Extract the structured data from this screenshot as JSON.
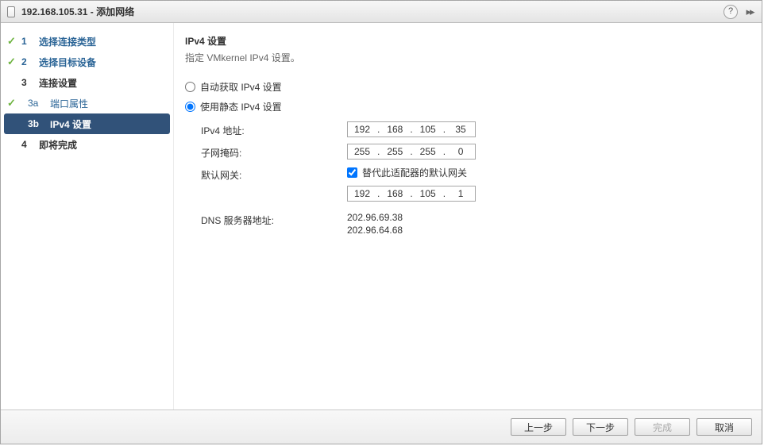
{
  "titlebar": {
    "title": "192.168.105.31 - 添加网络"
  },
  "sidebar": {
    "steps": [
      {
        "num": "1",
        "label": "选择连接类型",
        "done": true
      },
      {
        "num": "2",
        "label": "选择目标设备",
        "done": true
      },
      {
        "num": "3",
        "label": "连接设置",
        "done": false
      },
      {
        "num": "3a",
        "label": "端口属性",
        "done": true,
        "sub": true
      },
      {
        "num": "3b",
        "label": "IPv4 设置",
        "done": false,
        "sub": true,
        "active": true
      },
      {
        "num": "4",
        "label": "即将完成",
        "done": false
      }
    ]
  },
  "main": {
    "heading": "IPv4 设置",
    "desc": "指定 VMkernel IPv4 设置。",
    "radio_auto": "自动获取 IPv4 设置",
    "radio_static": "使用静态 IPv4 设置",
    "labels": {
      "ipv4_addr": "IPv4 地址:",
      "subnet": "子网掩码:",
      "gateway": "默认网关:",
      "gateway_override": "替代此适配器的默认网关",
      "dns": "DNS 服务器地址:"
    },
    "values": {
      "ip": [
        "192",
        "168",
        "105",
        "35"
      ],
      "mask": [
        "255",
        "255",
        "255",
        "0"
      ],
      "gateway_checked": true,
      "gw": [
        "192",
        "168",
        "105",
        "1"
      ],
      "dns1": "202.96.69.38",
      "dns2": "202.96.64.68"
    }
  },
  "footer": {
    "back": "上一步",
    "next": "下一步",
    "finish": "完成",
    "cancel": "取消"
  }
}
